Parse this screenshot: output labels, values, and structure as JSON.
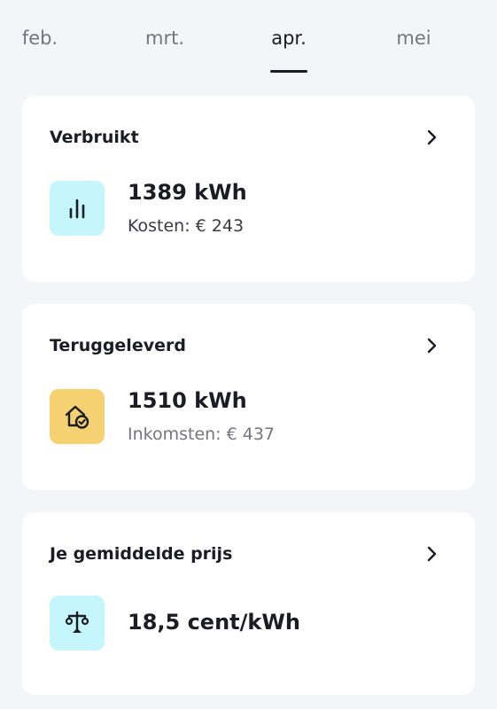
{
  "tabs": [
    {
      "label": "feb."
    },
    {
      "label": "mrt."
    },
    {
      "label": "apr."
    },
    {
      "label": "mei"
    }
  ],
  "active_tab": "apr.",
  "cards": [
    {
      "title": "Verbruikt",
      "value": "1389 kWh",
      "sub": "Kosten: € 243",
      "icon": "bar-chart-icon",
      "icon_bg": "#c5f6fb"
    },
    {
      "title": "Teruggeleverd",
      "value": "1510 kWh",
      "sub": "Inkomsten: € 437",
      "icon": "house-check-icon",
      "icon_bg": "#f6d171"
    },
    {
      "title": "Je gemiddelde prijs",
      "value": "18,5 cent/kWh",
      "icon": "scale-icon",
      "icon_bg": "#c5f6fb"
    }
  ]
}
